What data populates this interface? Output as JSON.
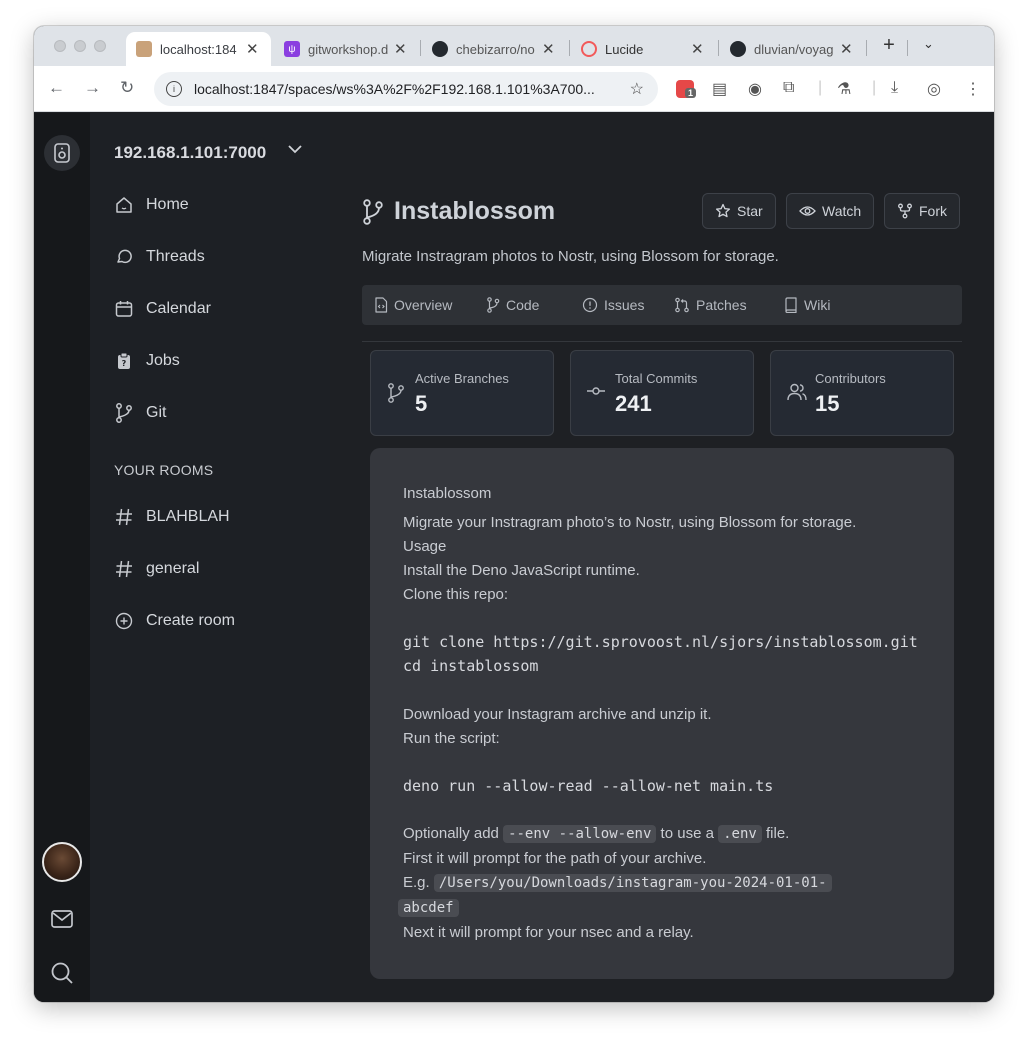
{
  "browser": {
    "tabs": [
      {
        "title": "localhost:184",
        "favicon_color": "#c9a27a",
        "active": true
      },
      {
        "title": "gitworkshop.d",
        "favicon_color": "#8b3fe0",
        "active": false
      },
      {
        "title": "chebizarro/no",
        "favicon_color": "#24292f",
        "active": false
      },
      {
        "title": "Lucide",
        "favicon_color": "#f25a5a",
        "active": false
      },
      {
        "title": "dluvian/voyag",
        "favicon_color": "#24292f",
        "active": false
      }
    ],
    "url": "localhost:1847/spaces/ws%3A%2F%2F192.168.1.101%3A700...",
    "extension_badge": "1"
  },
  "sidebar": {
    "server": "192.168.1.101:7000",
    "nav": [
      {
        "label": "Home",
        "icon": "home-icon"
      },
      {
        "label": "Threads",
        "icon": "threads-icon"
      },
      {
        "label": "Calendar",
        "icon": "calendar-icon"
      },
      {
        "label": "Jobs",
        "icon": "jobs-icon"
      },
      {
        "label": "Git",
        "icon": "git-branch-icon"
      }
    ],
    "rooms_heading": "YOUR ROOMS",
    "rooms": [
      {
        "label": "BLAHBLAH",
        "icon": "hash-icon"
      },
      {
        "label": "general",
        "icon": "hash-icon"
      }
    ],
    "create_room": "Create room"
  },
  "repo": {
    "title": "Instablossom",
    "description": "Migrate Instragram photos to Nostr, using Blossom for storage.",
    "actions": {
      "star": "Star",
      "watch": "Watch",
      "fork": "Fork"
    },
    "tabs": [
      {
        "label": "Overview",
        "icon": "file-code-icon"
      },
      {
        "label": "Code",
        "icon": "git-branch-icon"
      },
      {
        "label": "Issues",
        "icon": "alert-circle-icon"
      },
      {
        "label": "Patches",
        "icon": "git-pull-request-icon"
      },
      {
        "label": "Wiki",
        "icon": "book-icon"
      }
    ],
    "stats": [
      {
        "label": "Active Branches",
        "value": "5",
        "icon": "git-branch-icon"
      },
      {
        "label": "Total Commits",
        "value": "241",
        "icon": "git-commit-icon"
      },
      {
        "label": "Contributors",
        "value": "15",
        "icon": "users-icon"
      }
    ]
  },
  "readme": {
    "title": "Instablossom",
    "intro": "Migrate your Instragram photo’s to Nostr, using Blossom for storage.",
    "usage": "Usage",
    "step1": "Install the Deno JavaScript runtime.",
    "step2": "Clone this repo:",
    "code1_line1": "git clone https://git.sprovoost.nl/sjors/instablossom.git",
    "code1_line2": "cd instablossom",
    "step3": "Download your Instagram archive and unzip it.",
    "step4": "Run the script:",
    "code2": "deno run --allow-read --allow-net main.ts",
    "optional_prefix": "Optionally add",
    "optional_flags": "--env --allow-env",
    "optional_mid": "to use a",
    "optional_file": ".env",
    "optional_suffix": "file.",
    "prompt_path": "First it will prompt for the path of your archive.",
    "example_prefix": "E.g.",
    "example_path_1": "/Users/you/Downloads/instagram-you-2024-01-01-",
    "example_path_2": "abcdef",
    "prompt_nsec": "Next it will prompt for your nsec and a relay."
  }
}
